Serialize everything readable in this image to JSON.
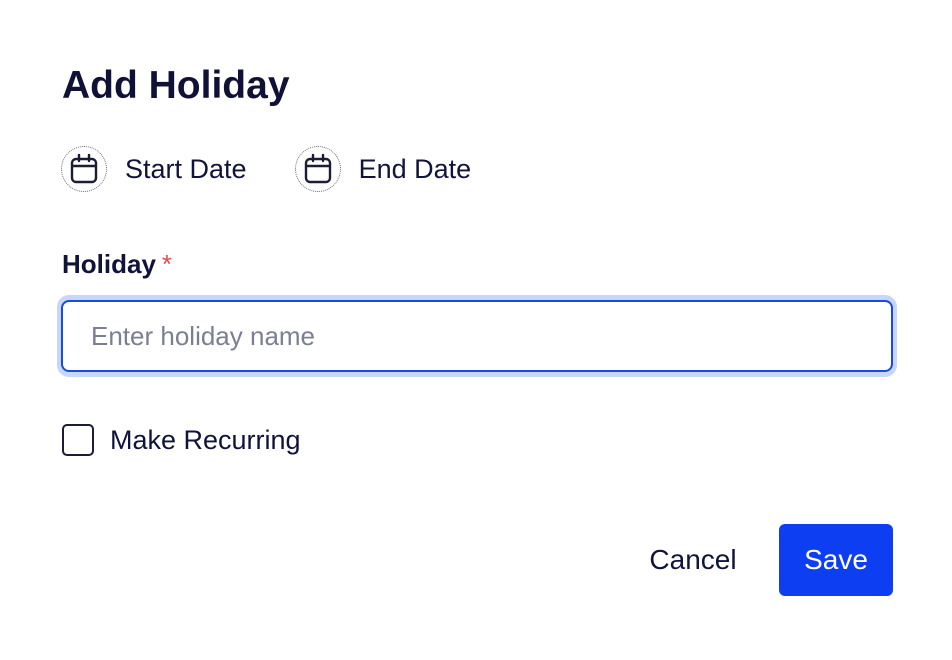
{
  "dialog": {
    "title": "Add Holiday"
  },
  "dates": {
    "start": {
      "label": "Start Date",
      "icon": "calendar-icon"
    },
    "end": {
      "label": "End Date",
      "icon": "calendar-icon"
    }
  },
  "holiday_field": {
    "label": "Holiday",
    "required_marker": "*",
    "value": "",
    "placeholder": "Enter holiday name"
  },
  "recurring": {
    "label": "Make Recurring",
    "checked": false
  },
  "actions": {
    "cancel_label": "Cancel",
    "save_label": "Save"
  },
  "colors": {
    "primary": "#0d3ef2",
    "focus_ring": "#c7d6fb",
    "required": "#e5484d",
    "text": "#10133a"
  }
}
